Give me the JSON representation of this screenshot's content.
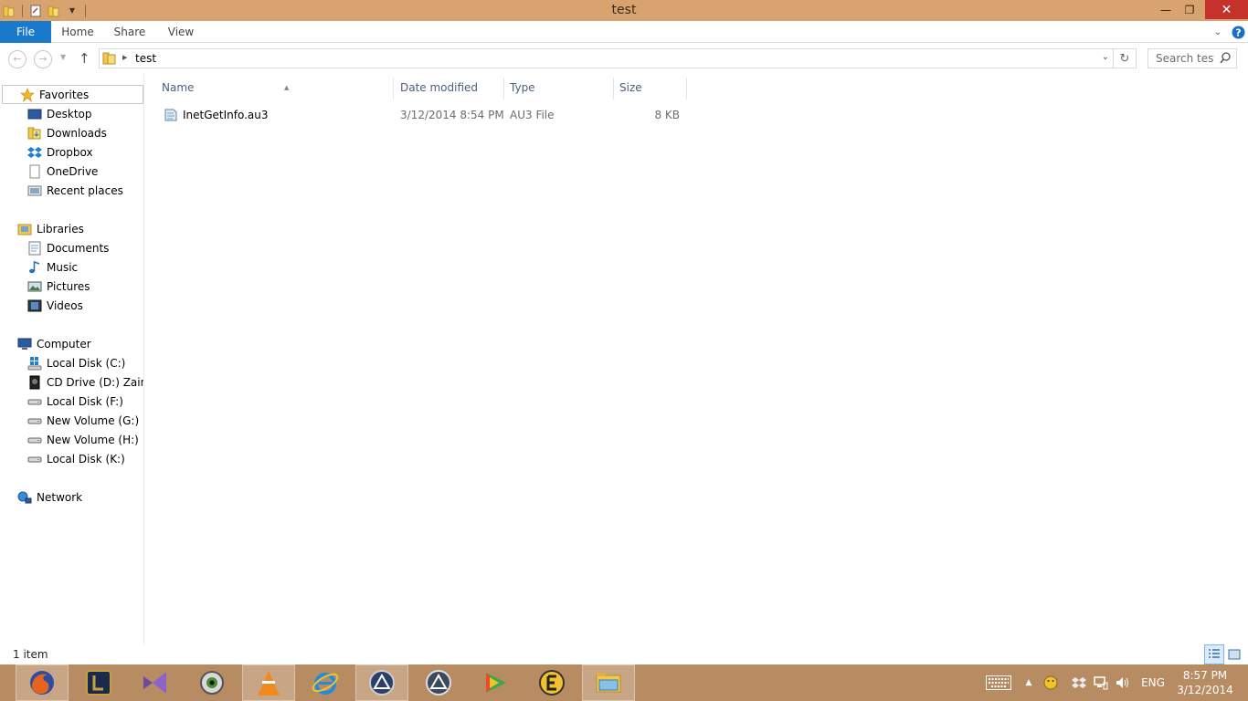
{
  "window": {
    "title": "test"
  },
  "ribbon": {
    "tabs": [
      {
        "label": "File"
      },
      {
        "label": "Home"
      },
      {
        "label": "Share"
      },
      {
        "label": "View"
      }
    ]
  },
  "address": {
    "crumb": "test",
    "search_placeholder": "Search test"
  },
  "navpane": {
    "favorites": {
      "label": "Favorites",
      "items": [
        {
          "label": "Desktop"
        },
        {
          "label": "Downloads"
        },
        {
          "label": "Dropbox"
        },
        {
          "label": "OneDrive"
        },
        {
          "label": "Recent places"
        }
      ]
    },
    "libraries": {
      "label": "Libraries",
      "items": [
        {
          "label": "Documents"
        },
        {
          "label": "Music"
        },
        {
          "label": "Pictures"
        },
        {
          "label": "Videos"
        }
      ]
    },
    "computer": {
      "label": "Computer",
      "items": [
        {
          "label": "Local Disk (C:)"
        },
        {
          "label": "CD Drive (D:) Zain Bi"
        },
        {
          "label": "Local Disk (F:)"
        },
        {
          "label": "New Volume (G:)"
        },
        {
          "label": "New Volume (H:)"
        },
        {
          "label": "Local Disk (K:)"
        }
      ]
    },
    "network": {
      "label": "Network"
    }
  },
  "columns": {
    "name": "Name",
    "date": "Date modified",
    "type": "Type",
    "size": "Size"
  },
  "files": [
    {
      "name": "InetGetInfo.au3",
      "date": "3/12/2014 8:54 PM",
      "type": "AU3 File",
      "size": "8 KB"
    }
  ],
  "status": {
    "count": "1 item"
  },
  "tray": {
    "lang": "ENG",
    "time": "8:57 PM",
    "date": "3/12/2014"
  },
  "colors": {
    "titlebar": "#d8a36e",
    "taskbar": "#b88c63",
    "file_tab": "#1979ca",
    "close": "#c7312b"
  }
}
